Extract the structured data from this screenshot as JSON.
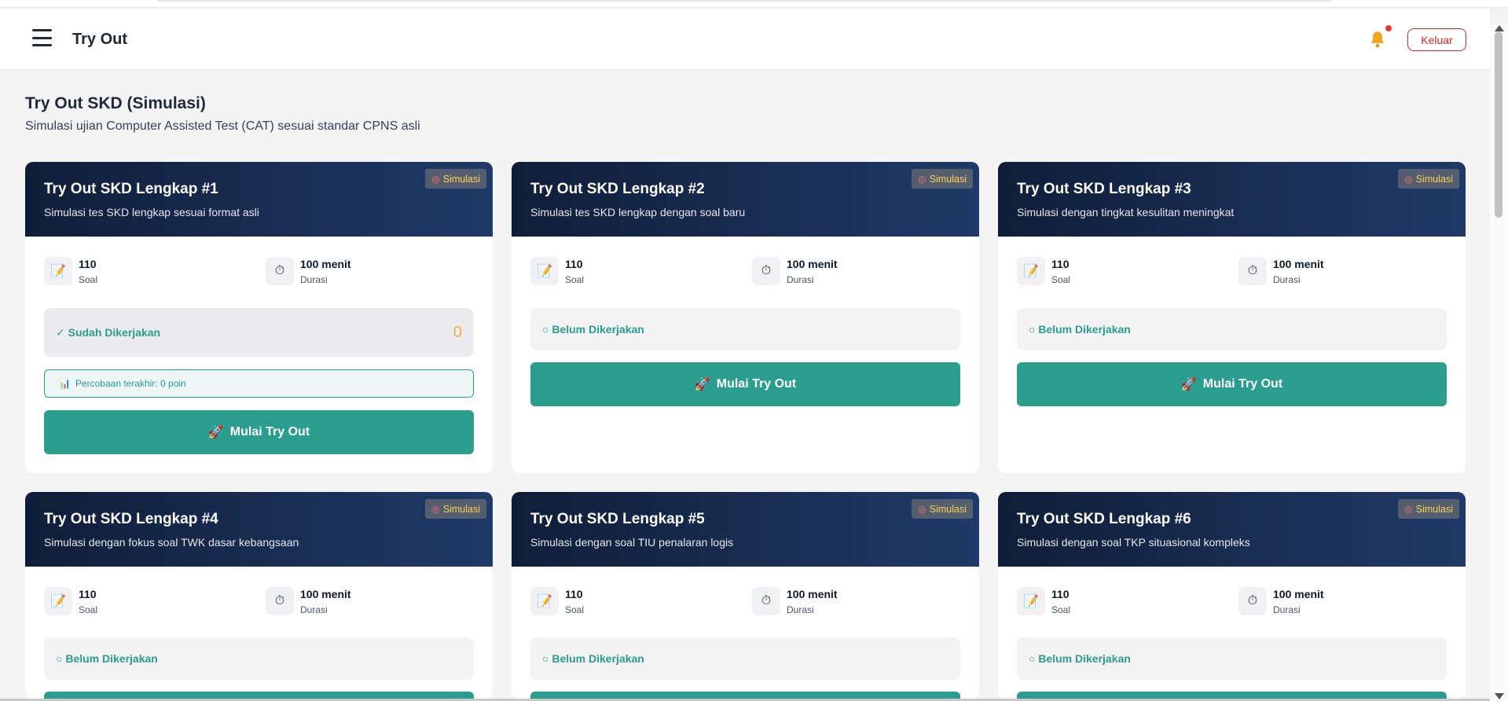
{
  "header": {
    "title": "Try Out",
    "logout_label": "Keluar"
  },
  "page": {
    "title": "Try Out SKD (Simulasi)",
    "subtitle": "Simulasi ujian Computer Assisted Test (CAT) sesuai standar CPNS asli"
  },
  "cards": [
    {
      "title": "Try Out SKD Lengkap #1",
      "description": "Simulasi tes SKD lengkap sesuai format asli",
      "badge": "Simulasi",
      "questions": "110",
      "questions_label": "Soal",
      "duration": "100 menit",
      "duration_label": "Durasi",
      "status": "✓ Sudah Dikerjakan",
      "score": "0",
      "last_attempt": "Percobaan terakhir: 0 poin",
      "button": "Mulai Try Out"
    },
    {
      "title": "Try Out SKD Lengkap #2",
      "description": "Simulasi tes SKD lengkap dengan soal baru",
      "badge": "Simulasi",
      "questions": "110",
      "questions_label": "Soal",
      "duration": "100 menit",
      "duration_label": "Durasi",
      "status": "○ Belum Dikerjakan",
      "button": "Mulai Try Out"
    },
    {
      "title": "Try Out SKD Lengkap #3",
      "description": "Simulasi dengan tingkat kesulitan meningkat",
      "badge": "Simulasi",
      "questions": "110",
      "questions_label": "Soal",
      "duration": "100 menit",
      "duration_label": "Durasi",
      "status": "○ Belum Dikerjakan",
      "button": "Mulai Try Out"
    },
    {
      "title": "Try Out SKD Lengkap #4",
      "description": "Simulasi dengan fokus soal TWK dasar kebangsaan",
      "badge": "Simulasi",
      "questions": "110",
      "questions_label": "Soal",
      "duration": "100 menit",
      "duration_label": "Durasi",
      "status": "○ Belum Dikerjakan"
    },
    {
      "title": "Try Out SKD Lengkap #5",
      "description": "Simulasi dengan soal TIU penalaran logis",
      "badge": "Simulasi",
      "questions": "110",
      "questions_label": "Soal",
      "duration": "100 menit",
      "duration_label": "Durasi",
      "status": "○ Belum Dikerjakan"
    },
    {
      "title": "Try Out SKD Lengkap #6",
      "description": "Simulasi dengan soal TKP situasional kompleks",
      "badge": "Simulasi",
      "questions": "110",
      "questions_label": "Soal",
      "duration": "100 menit",
      "duration_label": "Durasi",
      "status": "○ Belum Dikerjakan"
    }
  ],
  "colors": {
    "accent": "#2a9d8f",
    "header_gradient_start": "#0f1e38",
    "header_gradient_end": "#1f3a68",
    "logout": "#dc2626",
    "score": "#e8b04a"
  }
}
